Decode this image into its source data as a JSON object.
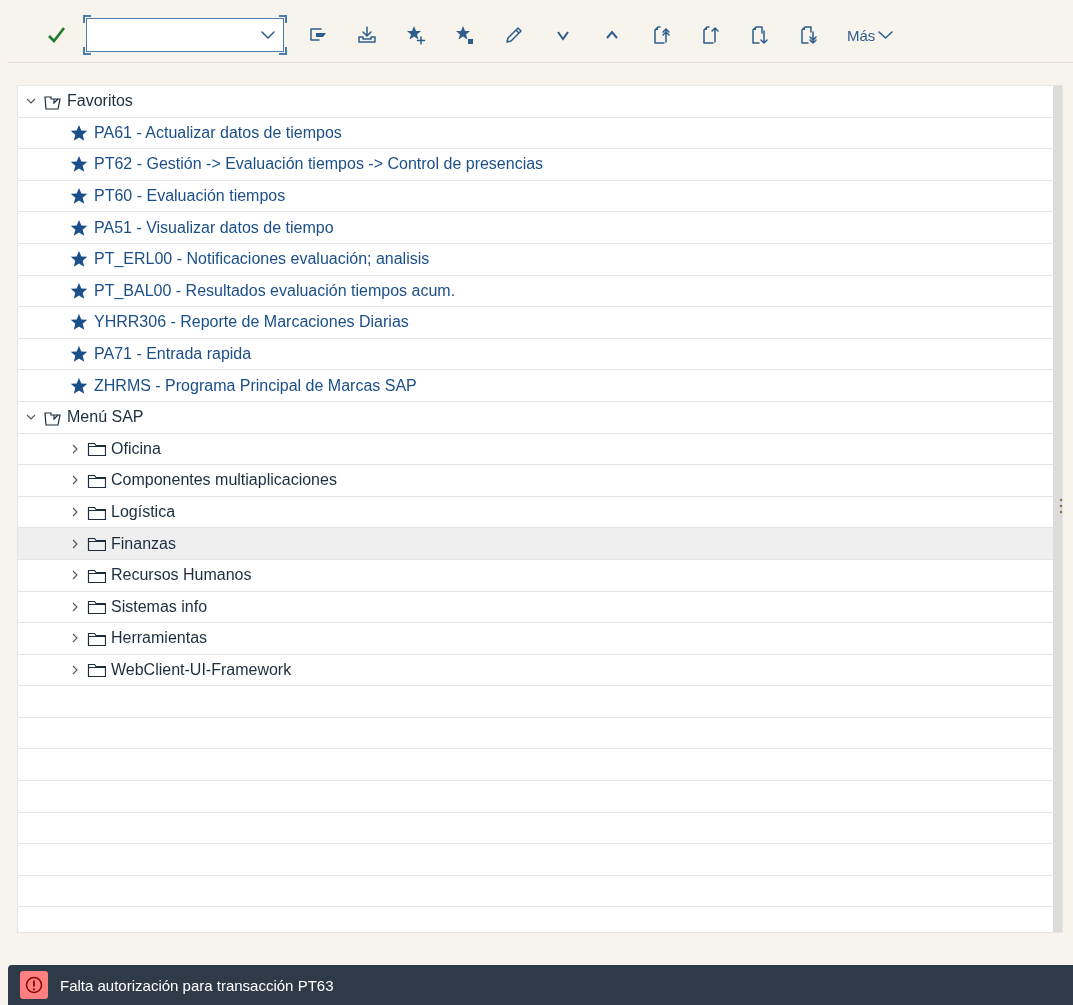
{
  "toolbar": {
    "more_label": "Más"
  },
  "tree": [
    {
      "label": "Favoritos",
      "kind": "root",
      "expanded": true,
      "highlighted": false,
      "children": [
        {
          "label": "PA61 - Actualizar datos de tiempos",
          "kind": "favorite",
          "highlighted": false
        },
        {
          "label": "PT62 - Gestión -> Evaluación tiempos -> Control de presencias",
          "kind": "favorite",
          "highlighted": false
        },
        {
          "label": "PT60 - Evaluación tiempos",
          "kind": "favorite",
          "highlighted": false
        },
        {
          "label": "PA51 - Visualizar datos de tiempo",
          "kind": "favorite",
          "highlighted": false
        },
        {
          "label": "PT_ERL00 - Notificaciones evaluación; analisis",
          "kind": "favorite",
          "highlighted": false
        },
        {
          "label": "PT_BAL00 - Resultados evaluación tiempos acum.",
          "kind": "favorite",
          "highlighted": false
        },
        {
          "label": "YHRR306 - Reporte de Marcaciones Diarias",
          "kind": "favorite",
          "highlighted": false
        },
        {
          "label": "PA71 - Entrada rapida",
          "kind": "favorite",
          "highlighted": false
        },
        {
          "label": "ZHRMS - Programa Principal de Marcas SAP",
          "kind": "favorite",
          "highlighted": false
        }
      ]
    },
    {
      "label": "Menú SAP",
      "kind": "root",
      "expanded": true,
      "highlighted": false,
      "children": [
        {
          "label": "Oficina",
          "kind": "folder",
          "expanded": false,
          "highlighted": false
        },
        {
          "label": "Componentes multiaplicaciones",
          "kind": "folder",
          "expanded": false,
          "highlighted": false
        },
        {
          "label": "Logística",
          "kind": "folder",
          "expanded": false,
          "highlighted": false
        },
        {
          "label": "Finanzas",
          "kind": "folder",
          "expanded": false,
          "highlighted": true
        },
        {
          "label": "Recursos Humanos",
          "kind": "folder",
          "expanded": false,
          "highlighted": false
        },
        {
          "label": "Sistemas info",
          "kind": "folder",
          "expanded": false,
          "highlighted": false
        },
        {
          "label": "Herramientas",
          "kind": "folder",
          "expanded": false,
          "highlighted": false
        },
        {
          "label": "WebClient-UI-Framework",
          "kind": "folder",
          "expanded": false,
          "highlighted": false
        }
      ]
    }
  ],
  "status_bar": {
    "kind": "error",
    "message": "Falta autorización para transacción PT63"
  }
}
